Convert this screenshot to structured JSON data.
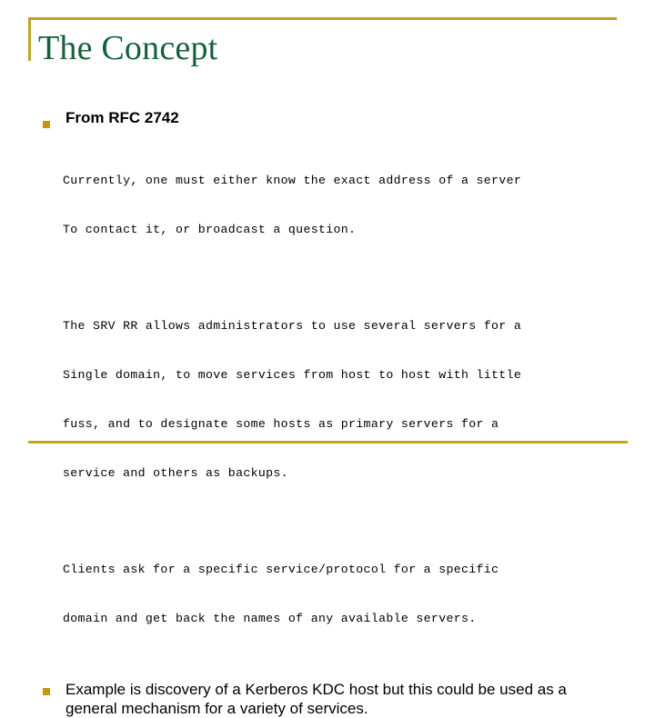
{
  "slide": {
    "title": "The Concept",
    "accent_gold": "#bfa22a",
    "bullet_gold": "#c8960c",
    "title_green": "#16613c"
  },
  "content": {
    "bullets": [
      {
        "marker": "square-bullet",
        "heading": "From RFC 2742"
      },
      {
        "marker": "square-bullet",
        "text": "Example is discovery of a Kerberos KDC host but this could be used as a general mechanism for a variety of services."
      }
    ],
    "quotes": [
      {
        "id": "quote-currently",
        "lines": [
          "Currently, one must either know the exact address of a server",
          "To contact it, or broadcast a question."
        ]
      },
      {
        "id": "quote-srv-rr",
        "lines": [
          "The SRV RR allows administrators to use several servers for a",
          "Single domain, to move services from host to host with little",
          "fuss, and to designate some hosts as primary servers for a",
          "service and others as backups."
        ]
      },
      {
        "id": "quote-clients",
        "lines": [
          "Clients ask for a specific service/protocol for a specific",
          "domain and get back the names of any available servers."
        ]
      }
    ]
  }
}
